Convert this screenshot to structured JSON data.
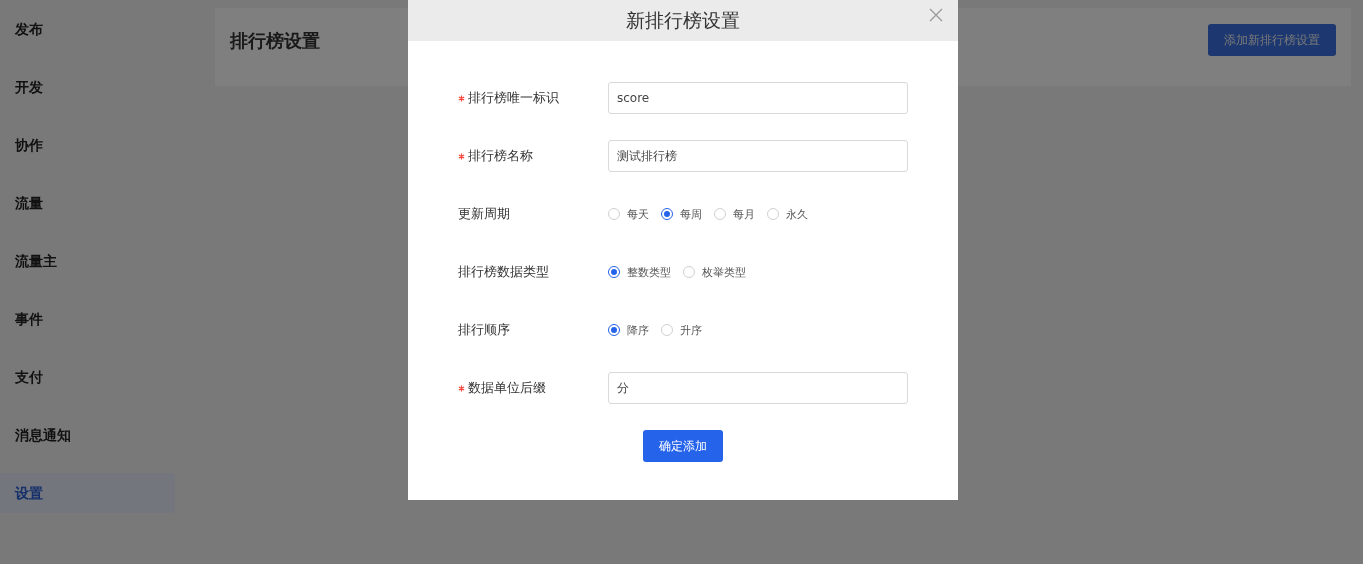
{
  "sidebar": {
    "items": [
      {
        "label": "发布",
        "selected": false
      },
      {
        "label": "开发",
        "selected": false
      },
      {
        "label": "协作",
        "selected": false
      },
      {
        "label": "流量",
        "selected": false
      },
      {
        "label": "流量主",
        "selected": false
      },
      {
        "label": "事件",
        "selected": false
      },
      {
        "label": "支付",
        "selected": false
      },
      {
        "label": "消息通知",
        "selected": false
      },
      {
        "label": "设置",
        "selected": true
      }
    ]
  },
  "page": {
    "title": "排行榜设置",
    "add_button": "添加新排行榜设置"
  },
  "dialog": {
    "title": "新排行榜设置",
    "fields": [
      {
        "kind": "text",
        "label": "排行榜唯一标识",
        "required": true,
        "value": "score"
      },
      {
        "kind": "text",
        "label": "排行榜名称",
        "required": true,
        "value": "测试排行榜"
      },
      {
        "kind": "radio",
        "label": "更新周期",
        "required": false,
        "options": [
          {
            "label": "每天",
            "selected": false
          },
          {
            "label": "每周",
            "selected": true
          },
          {
            "label": "每月",
            "selected": false
          },
          {
            "label": "永久",
            "selected": false
          }
        ]
      },
      {
        "kind": "radio",
        "label": "排行榜数据类型",
        "required": false,
        "options": [
          {
            "label": "整数类型",
            "selected": true
          },
          {
            "label": "枚举类型",
            "selected": false
          }
        ]
      },
      {
        "kind": "radio",
        "label": "排行顺序",
        "required": false,
        "options": [
          {
            "label": "降序",
            "selected": true
          },
          {
            "label": "升序",
            "selected": false
          }
        ]
      },
      {
        "kind": "text",
        "label": "数据单位后缀",
        "required": true,
        "value": "分"
      }
    ],
    "submit": "确定添加"
  }
}
